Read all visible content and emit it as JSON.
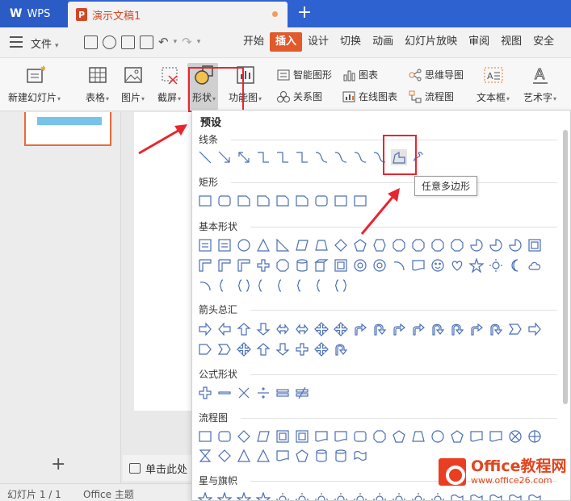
{
  "titlebar": {
    "app_tab": "WPS",
    "doc_tab": "演示文稿1",
    "doc_icon": "P",
    "new_tab": "+"
  },
  "menubar": {
    "file": "文件",
    "tabs": [
      "开始",
      "插入",
      "设计",
      "切换",
      "动画",
      "幻灯片放映",
      "审阅",
      "视图",
      "安全"
    ],
    "active_tab": "插入"
  },
  "ribbon": {
    "new_slide": "新建幻灯片",
    "table": "表格",
    "picture": "图片",
    "screenshot": "截屏",
    "shape": "形状",
    "function_chart": "功能图",
    "smart_graphic": "智能图形",
    "chart": "图表",
    "mind_map": "思维导图",
    "relation_chart": "关系图",
    "online_chart": "在线图表",
    "flowchart": "流程图",
    "textbox": "文本框",
    "wordart": "艺术字"
  },
  "dropdown": {
    "title": "预设",
    "categories": [
      "线条",
      "矩形",
      "基本形状",
      "箭头总汇",
      "公式形状",
      "流程图",
      "星与旗帜"
    ],
    "tooltip": "任意多边形"
  },
  "notes": {
    "label": "单击此处"
  },
  "statusbar": {
    "slide_info": "幻灯片 1 / 1",
    "theme": "Office 主题"
  },
  "watermark": {
    "brand": "Office教程网",
    "url": "www.office26.com"
  },
  "colors": {
    "title_bar": "#2f62d1",
    "accent": "#e05a2b",
    "highlight_box": "#e8262e",
    "shape_stroke": "#4a6fb5"
  }
}
